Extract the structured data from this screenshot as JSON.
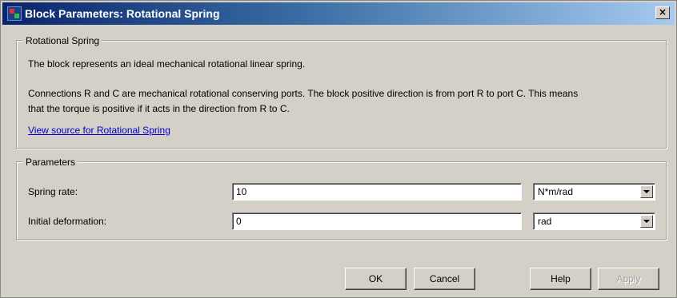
{
  "window": {
    "title": "Block Parameters: Rotational Spring",
    "close_glyph": "×"
  },
  "description": {
    "group_label": "Rotational Spring",
    "line1": "The block represents an ideal mechanical rotational linear spring.",
    "line2": "Connections R and C are mechanical rotational conserving ports. The block positive direction is from port R to port C. This means",
    "line3": "that the torque is positive if it acts in the direction from R to C.",
    "link": "View source for Rotational Spring"
  },
  "parameters": {
    "group_label": "Parameters",
    "spring_rate": {
      "label": "Spring rate:",
      "value": "10",
      "unit": "N*m/rad"
    },
    "initial_deformation": {
      "label": "Initial deformation:",
      "value": "0",
      "unit": "rad"
    }
  },
  "buttons": {
    "ok": "OK",
    "cancel": "Cancel",
    "help": "Help",
    "apply": "Apply"
  },
  "icons": {
    "app": "simulink-block-icon",
    "close": "close-icon",
    "dropdown": "chevron-down-icon"
  }
}
